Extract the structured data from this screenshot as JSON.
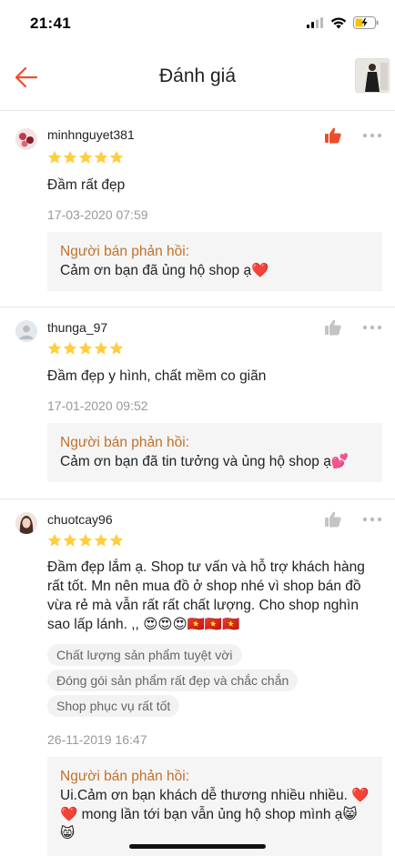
{
  "status_bar": {
    "time": "21:41"
  },
  "header": {
    "title": "Đánh giá"
  },
  "colors": {
    "accent": "#ee4d2d",
    "star": "#ffce3d",
    "reply_label": "#c0712b"
  },
  "reviews": [
    {
      "username": "minhnguyet381",
      "rating": 5,
      "liked": true,
      "text": "Đầm rất đẹp",
      "date": "17-03-2020 07:59",
      "reply_label": "Người bán phản hồi:",
      "reply_text": "Cảm ơn bạn đã ủng hộ shop ạ❤️"
    },
    {
      "username": "thunga_97",
      "rating": 5,
      "liked": false,
      "text": "Đầm đẹp y hình, chất mềm co giãn",
      "date": "17-01-2020 09:52",
      "reply_label": "Người bán phản hồi:",
      "reply_text": "Cảm ơn bạn đã tin tưởng và ủng hộ shop ạ💕"
    },
    {
      "username": "chuotcay96",
      "rating": 5,
      "liked": false,
      "text": "Đầm đẹp lắm ạ. Shop tư vấn và hỗ trợ khách hàng rất tốt. Mn nên mua đồ ở shop nhé vì shop bán đồ vừa rẻ mà vẫn rất rất chất lượng. Cho shop nghìn sao lấp lánh. ,, 😍😍😍🇻🇳🇻🇳🇻🇳",
      "tags": [
        "Chất lượng sản phẩm tuyệt vời",
        "Đóng gói sản phẩm rất đẹp và chắc chắn",
        "Shop phục vụ rất tốt"
      ],
      "date": "26-11-2019 16:47",
      "reply_label": "Người bán phản hồi:",
      "reply_text": "Ui.Cảm ơn bạn khách dễ thương nhiều nhiều. ❤️❤️ mong lần tới bạn vẫn ủng hộ shop mình ạ😸😸"
    }
  ]
}
